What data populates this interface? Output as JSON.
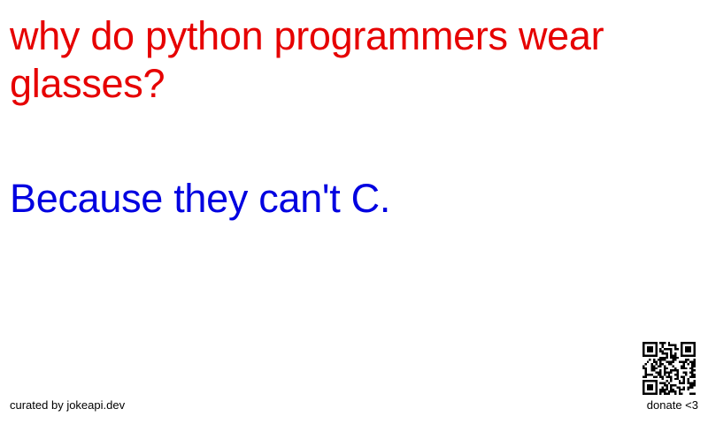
{
  "joke": {
    "setup": "why do python programmers wear glasses?",
    "delivery": "Because they can't C.",
    "setup_color": "#e60000",
    "delivery_color": "#0000e0"
  },
  "footer": {
    "credit": "curated by jokeapi.dev",
    "donate": "donate <3",
    "qr_icon": "qr-code-icon"
  }
}
